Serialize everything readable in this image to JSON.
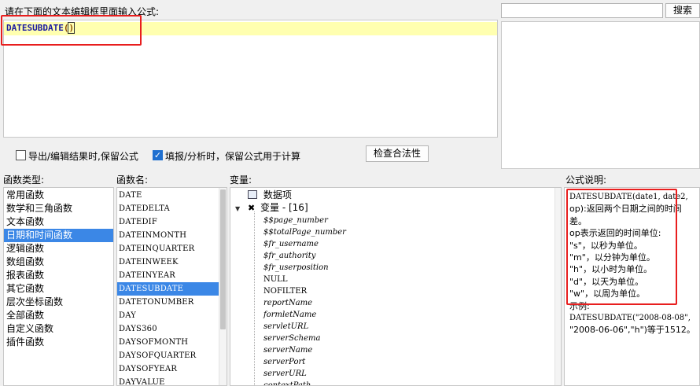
{
  "editor": {
    "prompt": "请在下面的文本编辑框里面输入公式:",
    "formula_name": "DATESUBDATE",
    "open_paren": "(",
    "close_paren": ")"
  },
  "search": {
    "input_value": "",
    "button_label": "搜索"
  },
  "options": {
    "export_keep": {
      "label": "导出/编辑结果时,保留公式",
      "checked": false
    },
    "fill_keep": {
      "label": "填报/分析时，保留公式用于计算",
      "checked": true
    },
    "validate_label": "检查合法性"
  },
  "sections": {
    "func_type": "函数类型:",
    "func_name": "函数名:",
    "variables": "变量:",
    "description": "公式说明:"
  },
  "func_types": [
    "常用函数",
    "数学和三角函数",
    "文本函数",
    "日期和时间函数",
    "逻辑函数",
    "数组函数",
    "报表函数",
    "其它函数",
    "层次坐标函数",
    "全部函数",
    "自定义函数",
    "插件函数"
  ],
  "func_type_selected": "日期和时间函数",
  "func_names": [
    "DATE",
    "DATEDELTA",
    "DATEDIF",
    "DATEINMONTH",
    "DATEINQUARTER",
    "DATEINWEEK",
    "DATEINYEAR",
    "DATESUBDATE",
    "DATETONUMBER",
    "DAY",
    "DAYS360",
    "DAYSOFMONTH",
    "DAYSOFQUARTER",
    "DAYSOFYEAR",
    "DAYVALUE"
  ],
  "func_name_selected": "DATESUBDATE",
  "variables": {
    "data_item": "数据项",
    "var_group": "变量 - [16]",
    "expand_icon": "▼",
    "items": [
      "$$page_number",
      "$$totalPage_number",
      "$fr_username",
      "$fr_authority",
      "$fr_userposition",
      "NULL",
      "NOFILTER",
      "reportName",
      "formletName",
      "servletURL",
      "serverSchema",
      "serverName",
      "serverPort",
      "serverURL",
      "contextPath"
    ]
  },
  "description": {
    "lines": [
      "DATESUBDATE(date1, date2,",
      "op):返回两个日期之间的时间",
      "差。",
      "op表示返回的时间单位:",
      "\"s\"，以秒为单位。",
      "\"m\"，以分钟为单位。",
      "\"h\"，以小时为单位。",
      "\"d\"，以天为单位。",
      "\"w\"，以周为单位。",
      "示例:",
      "DATESUBDATE(\"2008-08-08\",",
      "\"2008-06-06\",\"h\")等于1512。"
    ]
  },
  "colors": {
    "accent_red": "#e81e1e",
    "selection_blue": "#3b87e6",
    "formula_blue": "#1a1aa0",
    "editor_highlight": "#ffffb0"
  }
}
